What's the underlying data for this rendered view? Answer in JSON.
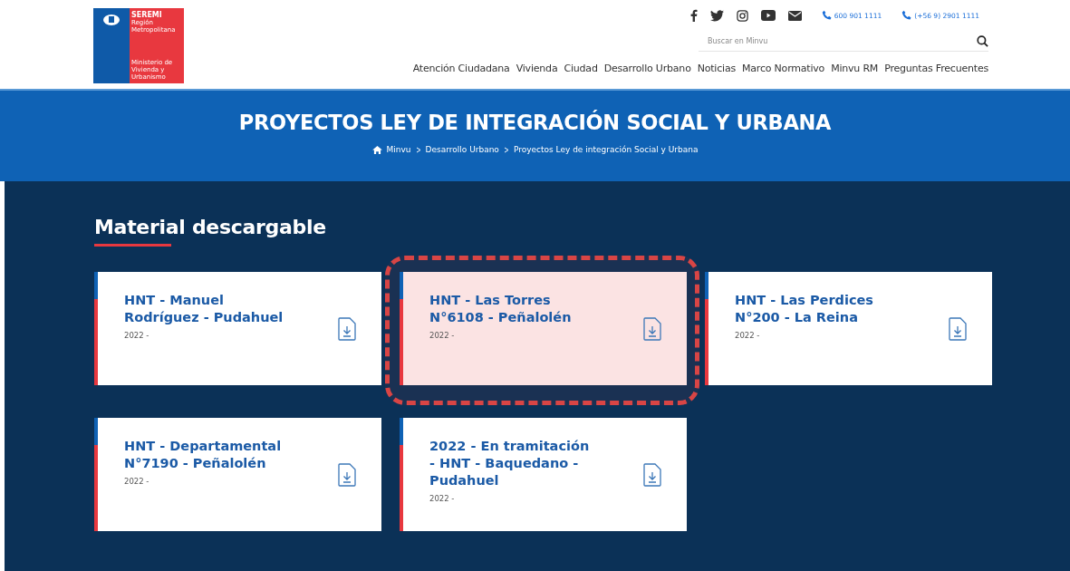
{
  "logo": {
    "title": "SEREMI",
    "region": "Región Metropolitana",
    "ministry": "Ministerio de Vivienda y Urbanismo"
  },
  "contacts": [
    {
      "kind": "phone",
      "label": "600 901 1111"
    },
    {
      "kind": "phone",
      "label": "(+56 9) 2901 1111"
    }
  ],
  "search": {
    "placeholder": "Buscar en Minvu"
  },
  "nav": [
    "Atención Ciudadana",
    "Vivienda",
    "Ciudad",
    "Desarrollo Urbano",
    "Noticias",
    "Marco Normativo",
    "Minvu RM",
    "Preguntas Frecuentes"
  ],
  "banner": {
    "title": "PROYECTOS LEY DE INTEGRACIÓN SOCIAL Y URBANA",
    "breadcrumb": [
      "Minvu",
      "Desarrollo Urbano",
      "Proyectos Ley de integración Social y Urbana"
    ]
  },
  "section": {
    "title": "Material descargable"
  },
  "cards": [
    {
      "title": "HNT - Manuel Rodríguez - Pudahuel",
      "date": "2022 -",
      "highlighted": false
    },
    {
      "title": "HNT - Las Torres N°6108 - Peñalolén",
      "date": "2022 -",
      "highlighted": true
    },
    {
      "title": "HNT - Las Perdices N°200 - La Reina",
      "date": "2022 -",
      "highlighted": false
    },
    {
      "title": "HNT - Departamental N°7190 - Peñalolén",
      "date": "2022 -",
      "highlighted": false
    },
    {
      "title": "2022 - En tramitación - HNT - Baquedano - Pudahuel",
      "date": "2022 -",
      "highlighted": false
    }
  ]
}
